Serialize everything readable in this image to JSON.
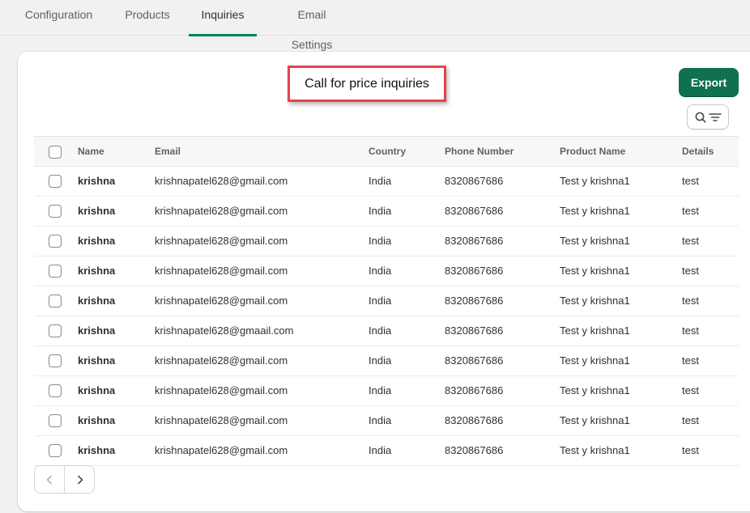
{
  "tabs": [
    {
      "label": "Configuration",
      "active": false
    },
    {
      "label": "Products",
      "active": false
    },
    {
      "label": "Inquiries",
      "active": true
    },
    {
      "label": "Email Settings",
      "active": false
    }
  ],
  "card": {
    "title": "Call for price inquiries",
    "export_label": "Export",
    "filter_icon": "search-filter-icon"
  },
  "table": {
    "columns": [
      "Name",
      "Email",
      "Country",
      "Phone Number",
      "Product Name",
      "Details"
    ],
    "rows": [
      {
        "name": "krishna",
        "email": "krishnapatel628@gmail.com",
        "country": "India",
        "phone": "8320867686",
        "product": "Test y krishna1",
        "details": "test"
      },
      {
        "name": "krishna",
        "email": "krishnapatel628@gmail.com",
        "country": "India",
        "phone": "8320867686",
        "product": "Test y krishna1",
        "details": "test"
      },
      {
        "name": "krishna",
        "email": "krishnapatel628@gmail.com",
        "country": "India",
        "phone": "8320867686",
        "product": "Test y krishna1",
        "details": "test"
      },
      {
        "name": "krishna",
        "email": "krishnapatel628@gmail.com",
        "country": "India",
        "phone": "8320867686",
        "product": "Test y krishna1",
        "details": "test"
      },
      {
        "name": "krishna",
        "email": "krishnapatel628@gmail.com",
        "country": "India",
        "phone": "8320867686",
        "product": "Test y krishna1",
        "details": "test"
      },
      {
        "name": "krishna",
        "email": "krishnapatel628@gmaail.com",
        "country": "India",
        "phone": "8320867686",
        "product": "Test y krishna1",
        "details": "test"
      },
      {
        "name": "krishna",
        "email": "krishnapatel628@gmail.com",
        "country": "India",
        "phone": "8320867686",
        "product": "Test y krishna1",
        "details": "test"
      },
      {
        "name": "krishna",
        "email": "krishnapatel628@gmail.com",
        "country": "India",
        "phone": "8320867686",
        "product": "Test y krishna1",
        "details": "test"
      },
      {
        "name": "krishna",
        "email": "krishnapatel628@gmail.com",
        "country": "India",
        "phone": "8320867686",
        "product": "Test y krishna1",
        "details": "test"
      },
      {
        "name": "krishna",
        "email": "krishnapatel628@gmail.com",
        "country": "India",
        "phone": "8320867686",
        "product": "Test y krishna1",
        "details": "test"
      }
    ]
  },
  "pagination": {
    "prev_icon": "chevron-left-icon",
    "next_icon": "chevron-right-icon"
  },
  "colors": {
    "accent": "#008060",
    "export_bg": "#0f7150",
    "highlight_border": "#e8434b"
  }
}
